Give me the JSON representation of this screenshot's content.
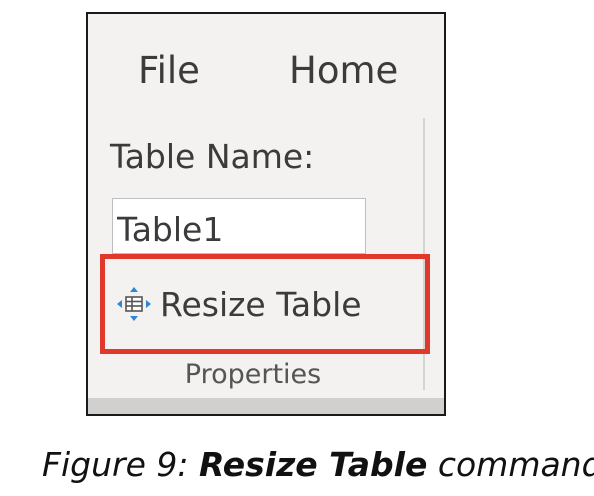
{
  "ribbon": {
    "tabs": [
      {
        "label": "File"
      },
      {
        "label": "Home"
      }
    ],
    "table_name_label": "Table Name:",
    "table_name_value": "Table1",
    "resize_table_label": "Resize Table",
    "group_label": "Properties",
    "highlight_color": "#e0392b",
    "resize_icon": "table-move-resize-icon"
  },
  "caption": {
    "prefix": "Figure 9: ",
    "bold": "Resize Table",
    "suffix": " command"
  }
}
